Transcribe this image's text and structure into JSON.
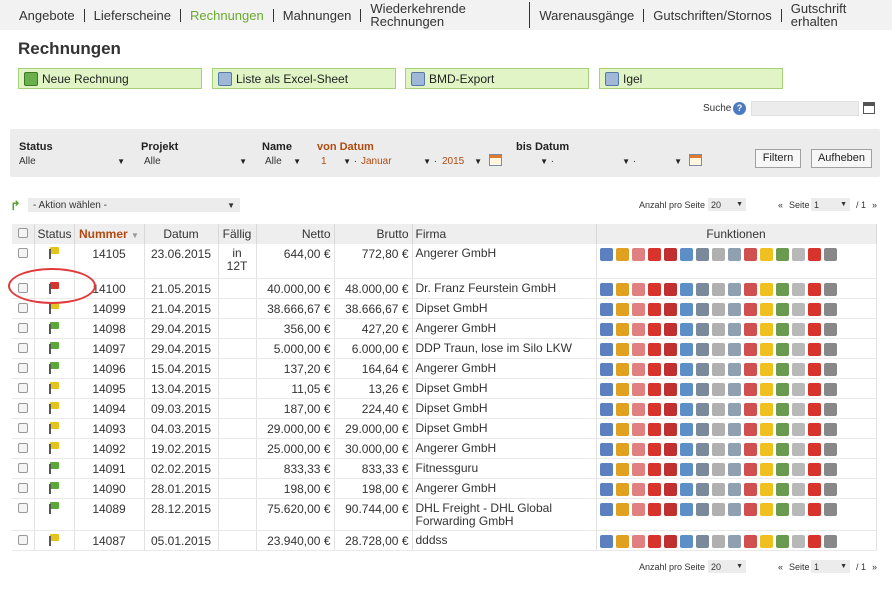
{
  "nav": [
    {
      "label": "Angebote",
      "active": false
    },
    {
      "label": "Lieferscheine",
      "active": false
    },
    {
      "label": "Rechnungen",
      "active": true
    },
    {
      "label": "Mahnungen",
      "active": false
    },
    {
      "label": "Wiederkehrende Rechnungen",
      "active": false
    },
    {
      "label": "Warenausgänge",
      "active": false
    },
    {
      "label": "Gutschriften/Stornos",
      "active": false
    },
    {
      "label": "Gutschrift erhalten",
      "active": false
    }
  ],
  "page_title": "Rechnungen",
  "actions": {
    "new_invoice": "Neue Rechnung",
    "excel": "Liste als Excel-Sheet",
    "bmd": "BMD-Export",
    "igel": "Igel"
  },
  "search": {
    "label": "Suche",
    "help": "?",
    "value": ""
  },
  "filters": {
    "status_label": "Status",
    "status_value": "Alle",
    "projekt_label": "Projekt",
    "projekt_value": "Alle",
    "name_label": "Name",
    "name_value": "Alle",
    "von_label": "von Datum",
    "von_day": "1",
    "von_month": "Januar",
    "von_year": "2015",
    "bis_label": "bis Datum",
    "bis_day": "",
    "bis_month": "",
    "bis_year": "",
    "filter_button": "Filtern",
    "reset_button": "Aufheben"
  },
  "bulk_action": "- Aktion wählen -",
  "pagination": {
    "per_page_label": "Anzahl pro Seite",
    "per_page": "20",
    "prev": "«",
    "page_label": "Seite",
    "page": "1",
    "of": "/ 1",
    "next": "»"
  },
  "table": {
    "headers": {
      "status": "Status",
      "nummer": "Nummer",
      "datum": "Datum",
      "faellig": "Fällig",
      "netto": "Netto",
      "brutto": "Brutto",
      "firma": "Firma",
      "funktionen": "Funktionen"
    },
    "rows": [
      {
        "status_color": "#e6c21f",
        "nummer": "14105",
        "datum": "23.06.2015",
        "faellig": "in 12T",
        "netto": "644,00 €",
        "brutto": "772,80 €",
        "firma": "Angerer GmbH"
      },
      {
        "status_color": "#d9342b",
        "nummer": "14100",
        "datum": "21.05.2015",
        "faellig": "",
        "netto": "40.000,00 €",
        "brutto": "48.000,00 €",
        "firma": "Dr. Franz Feurstein GmbH"
      },
      {
        "status_color": "#e6c21f",
        "nummer": "14099",
        "datum": "21.04.2015",
        "faellig": "",
        "netto": "38.666,67 €",
        "brutto": "38.666,67 €",
        "firma": "Dipset GmbH"
      },
      {
        "status_color": "#5aa83a",
        "nummer": "14098",
        "datum": "29.04.2015",
        "faellig": "",
        "netto": "356,00 €",
        "brutto": "427,20 €",
        "firma": "Angerer GmbH"
      },
      {
        "status_color": "#5aa83a",
        "nummer": "14097",
        "datum": "29.04.2015",
        "faellig": "",
        "netto": "5.000,00 €",
        "brutto": "6.000,00 €",
        "firma": "DDP Traun, lose im Silo LKW"
      },
      {
        "status_color": "#5aa83a",
        "nummer": "14096",
        "datum": "15.04.2015",
        "faellig": "",
        "netto": "137,20 €",
        "brutto": "164,64 €",
        "firma": "Angerer GmbH"
      },
      {
        "status_color": "#e6c21f",
        "nummer": "14095",
        "datum": "13.04.2015",
        "faellig": "",
        "netto": "11,05 €",
        "brutto": "13,26 €",
        "firma": "Dipset GmbH"
      },
      {
        "status_color": "#e6c21f",
        "nummer": "14094",
        "datum": "09.03.2015",
        "faellig": "",
        "netto": "187,00 €",
        "brutto": "224,40 €",
        "firma": "Dipset GmbH"
      },
      {
        "status_color": "#e6c21f",
        "nummer": "14093",
        "datum": "04.03.2015",
        "faellig": "",
        "netto": "29.000,00 €",
        "brutto": "29.000,00 €",
        "firma": "Dipset GmbH"
      },
      {
        "status_color": "#e6c21f",
        "nummer": "14092",
        "datum": "19.02.2015",
        "faellig": "",
        "netto": "25.000,00 €",
        "brutto": "30.000,00 €",
        "firma": "Angerer GmbH"
      },
      {
        "status_color": "#5aa83a",
        "nummer": "14091",
        "datum": "02.02.2015",
        "faellig": "",
        "netto": "833,33 €",
        "brutto": "833,33 €",
        "firma": "Fitnessguru"
      },
      {
        "status_color": "#5aa83a",
        "nummer": "14090",
        "datum": "28.01.2015",
        "faellig": "",
        "netto": "198,00 €",
        "brutto": "198,00 €",
        "firma": "Angerer GmbH"
      },
      {
        "status_color": "#5aa83a",
        "nummer": "14089",
        "datum": "28.12.2015",
        "faellig": "",
        "netto": "75.620,00 €",
        "brutto": "90.744,00 €",
        "firma": "DHL Freight - DHL Global Forwarding GmbH"
      },
      {
        "status_color": "#e6c21f",
        "nummer": "14087",
        "datum": "05.01.2015",
        "faellig": "",
        "netto": "23.940,00 €",
        "brutto": "28.728,00 €",
        "firma": "dddss"
      }
    ]
  },
  "function_icons": [
    {
      "name": "search-icon",
      "color": "#5b7fbf"
    },
    {
      "name": "edit-icon",
      "color": "#e0a020"
    },
    {
      "name": "payment-icon",
      "color": "#e08080"
    },
    {
      "name": "pdf-icon",
      "color": "#d9342b"
    },
    {
      "name": "code-icon",
      "color": "#c03030"
    },
    {
      "name": "email-icon",
      "color": "#5c8fc8"
    },
    {
      "name": "cart-icon",
      "color": "#7a8a9a"
    },
    {
      "name": "document-icon",
      "color": "#b0b0b0"
    },
    {
      "name": "stamp-icon",
      "color": "#8fa0b0"
    },
    {
      "name": "document-red-icon",
      "color": "#d05050"
    },
    {
      "name": "warning-icon",
      "color": "#f0c020"
    },
    {
      "name": "clock-icon",
      "color": "#6a9a50"
    },
    {
      "name": "copy-icon",
      "color": "#b8b8b8"
    },
    {
      "name": "flag-icon",
      "color": "#d9342b"
    },
    {
      "name": "delete-icon",
      "color": "#888888"
    }
  ]
}
